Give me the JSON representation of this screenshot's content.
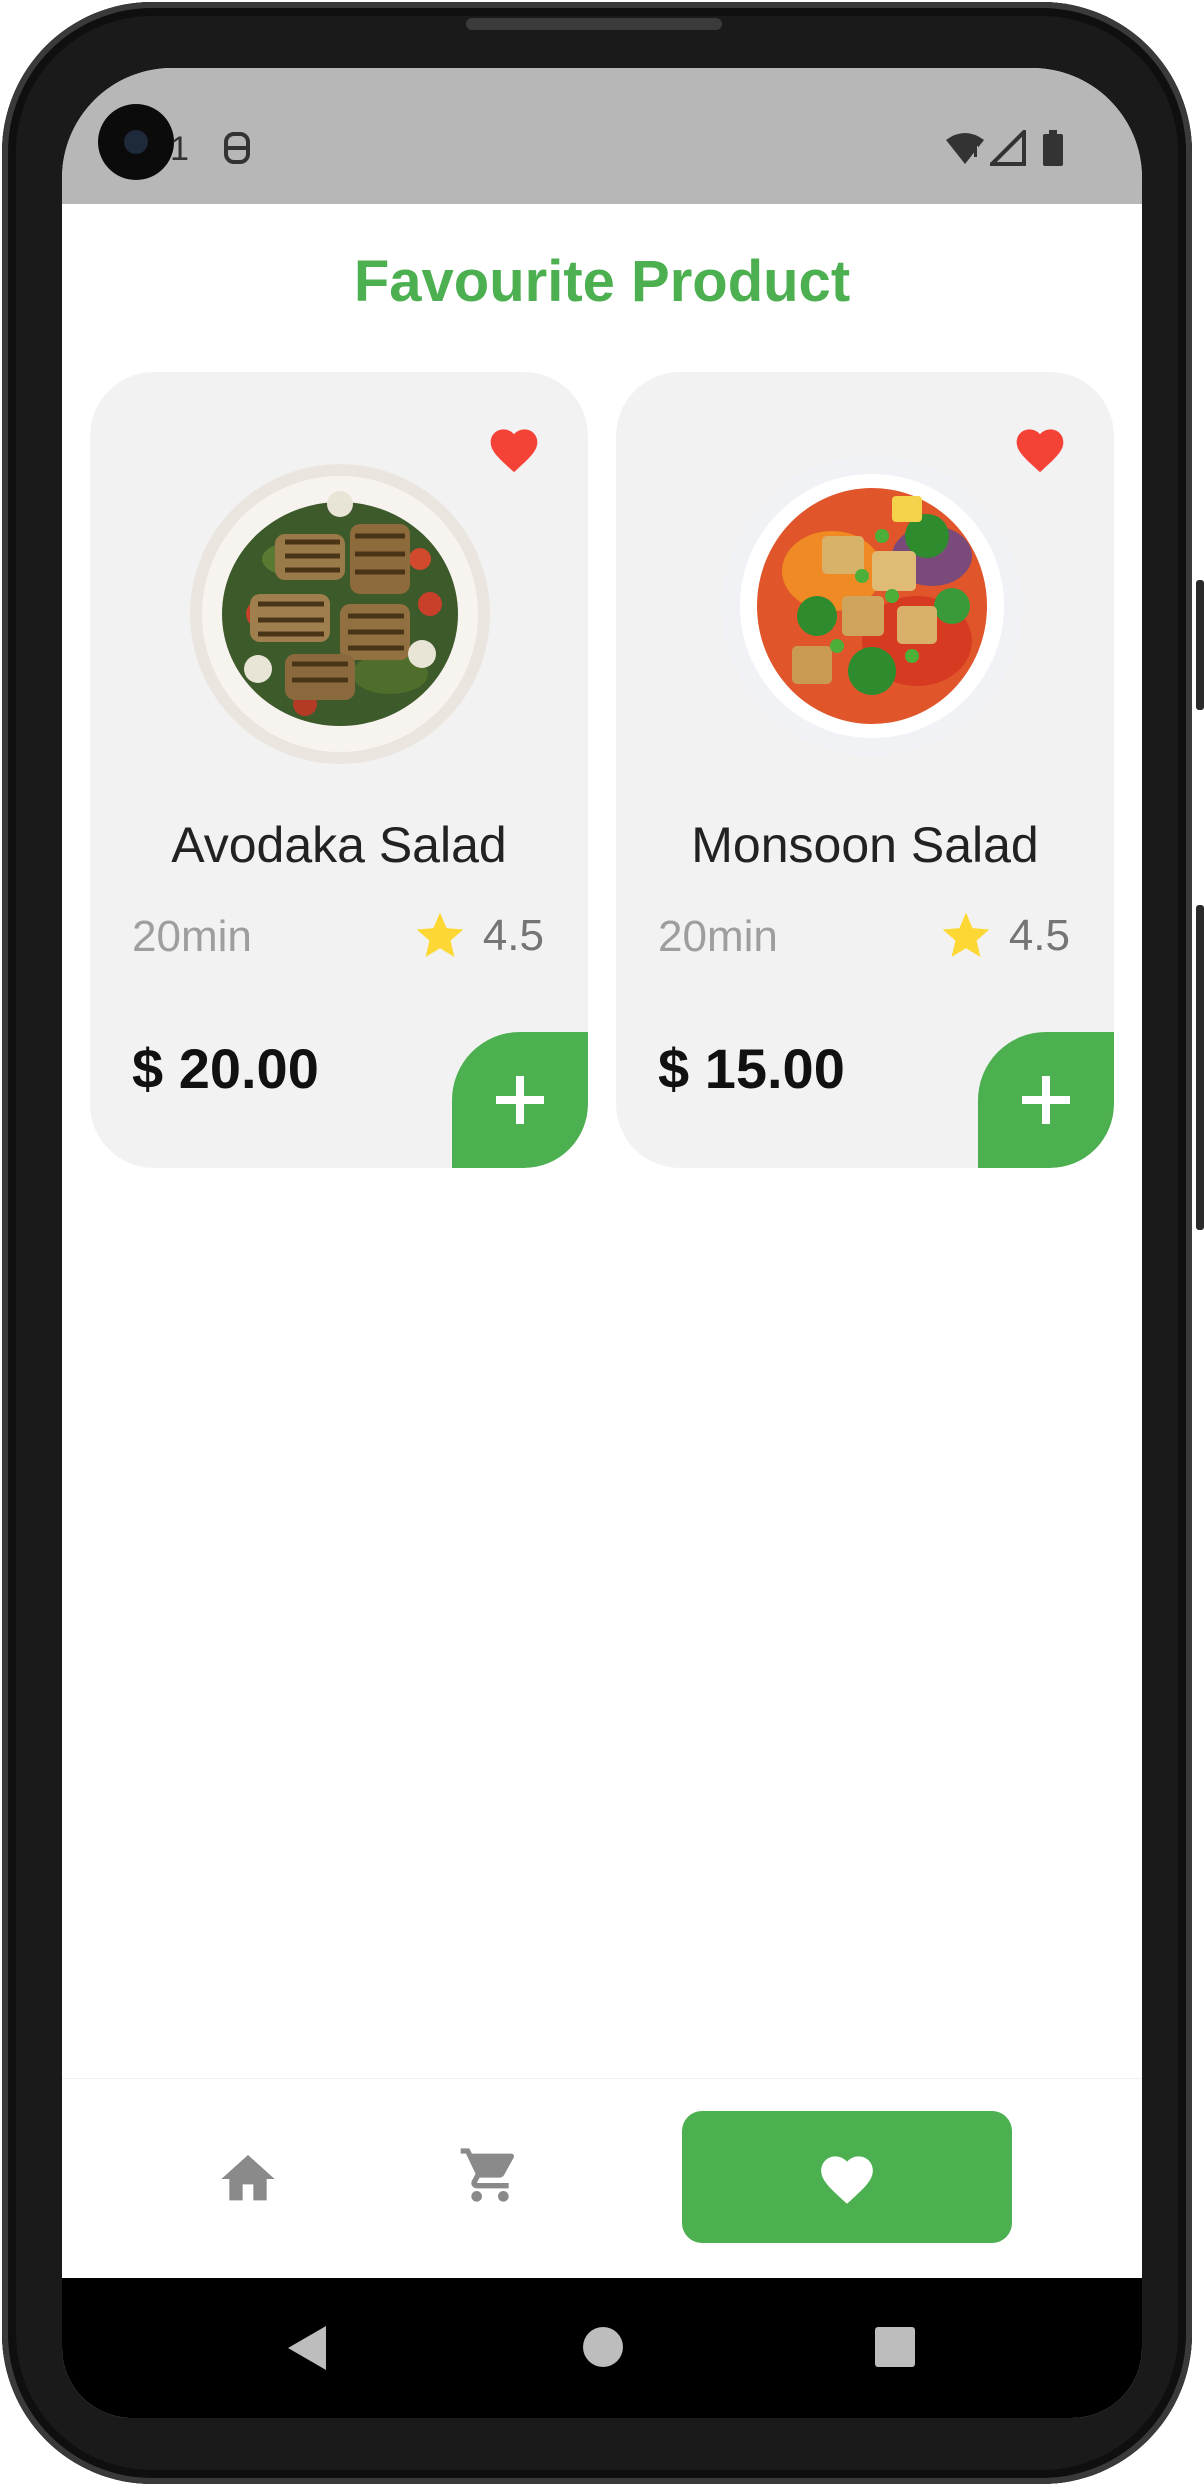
{
  "status_bar": {
    "time": "1",
    "icons": [
      "notification-icon",
      "wifi-icon",
      "signal-icon",
      "battery-icon"
    ]
  },
  "page": {
    "title": "Favourite Product"
  },
  "products": [
    {
      "name": "Avodaka Salad",
      "time": "20min",
      "rating": "4.5",
      "price": "$ 20.00",
      "favourite": true,
      "image": "grilled-halloumi-salad-image"
    },
    {
      "name": "Monsoon Salad",
      "time": "20min",
      "rating": "4.5",
      "price": "$ 15.00",
      "favourite": true,
      "image": "tofu-vegetable-salad-image"
    }
  ],
  "bottom_nav": {
    "items": [
      "home-icon",
      "cart-icon",
      "heart-icon"
    ],
    "active": "heart-icon"
  },
  "system_nav": [
    "back-icon",
    "home-circle-icon",
    "recents-icon"
  ],
  "colors": {
    "accent": "#4caf50",
    "favourite": "#f44336",
    "star": "#fdd835",
    "card_background": "#f2f2f2",
    "status_bar": "#b7b7b7"
  }
}
